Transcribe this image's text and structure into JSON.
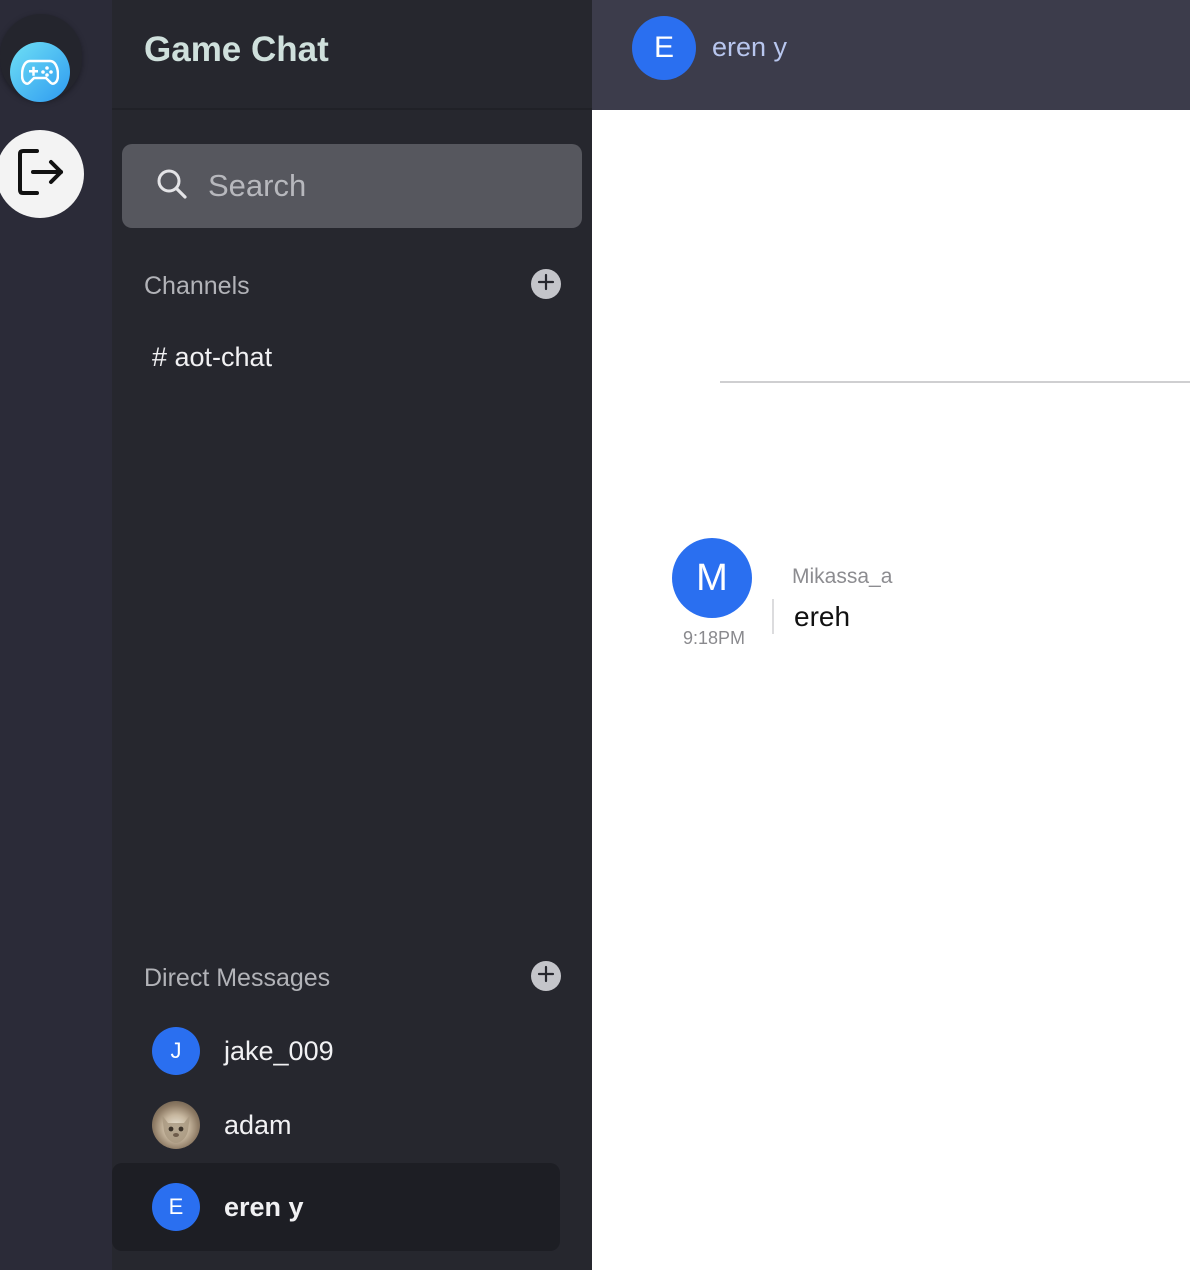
{
  "app": {
    "title": "Game Chat"
  },
  "rail": {
    "logo_icon": "gamepad-icon",
    "logout_icon": "logout-icon"
  },
  "search": {
    "placeholder": "Search",
    "value": ""
  },
  "channels": {
    "label": "Channels",
    "items": [
      {
        "label": "# aot-chat"
      }
    ]
  },
  "direct_messages": {
    "label": "Direct Messages",
    "items": [
      {
        "initial": "J",
        "name": "jake_009",
        "avatar_type": "initial"
      },
      {
        "initial": "",
        "name": "adam",
        "avatar_type": "photo"
      },
      {
        "initial": "E",
        "name": "eren y",
        "avatar_type": "initial",
        "active": true
      }
    ]
  },
  "chat_header": {
    "initial": "E",
    "name": "eren y"
  },
  "messages": [
    {
      "initial": "M",
      "author": "Mikassa_a",
      "time": "9:18PM",
      "text": "ereh"
    }
  ],
  "colors": {
    "accent": "#2a6ff0",
    "sidebar_bg": "#26272e",
    "rail_bg": "#2b2b38",
    "topbar_bg": "#3c3c4b"
  }
}
